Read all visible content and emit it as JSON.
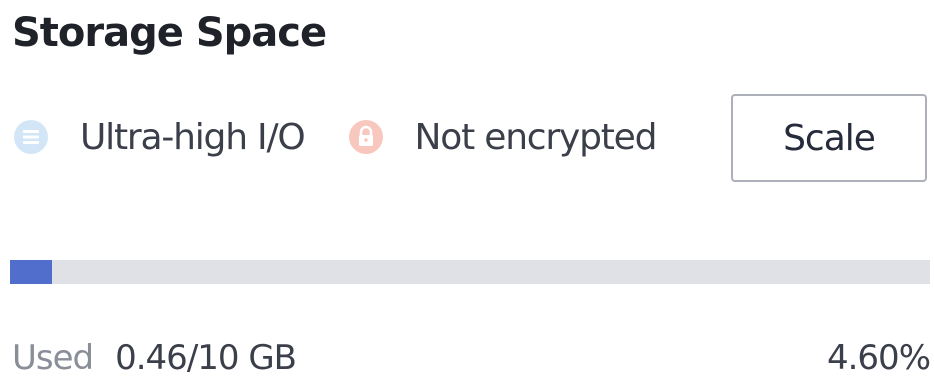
{
  "header": {
    "title": "Storage Space"
  },
  "tags": [
    {
      "icon": "storage-disk-icon",
      "label": "Ultra-high I/O",
      "color": "#d2e6f7"
    },
    {
      "icon": "lock-icon",
      "label": "Not encrypted",
      "color": "#f8c8be"
    }
  ],
  "actions": {
    "scale_label": "Scale"
  },
  "usage": {
    "used_label": "Used",
    "used_value": "0.46/10 GB",
    "percent_text": "4.60%",
    "percent": 4.6,
    "bar_color": "#526ecc",
    "track_color": "#dfe1e6"
  }
}
